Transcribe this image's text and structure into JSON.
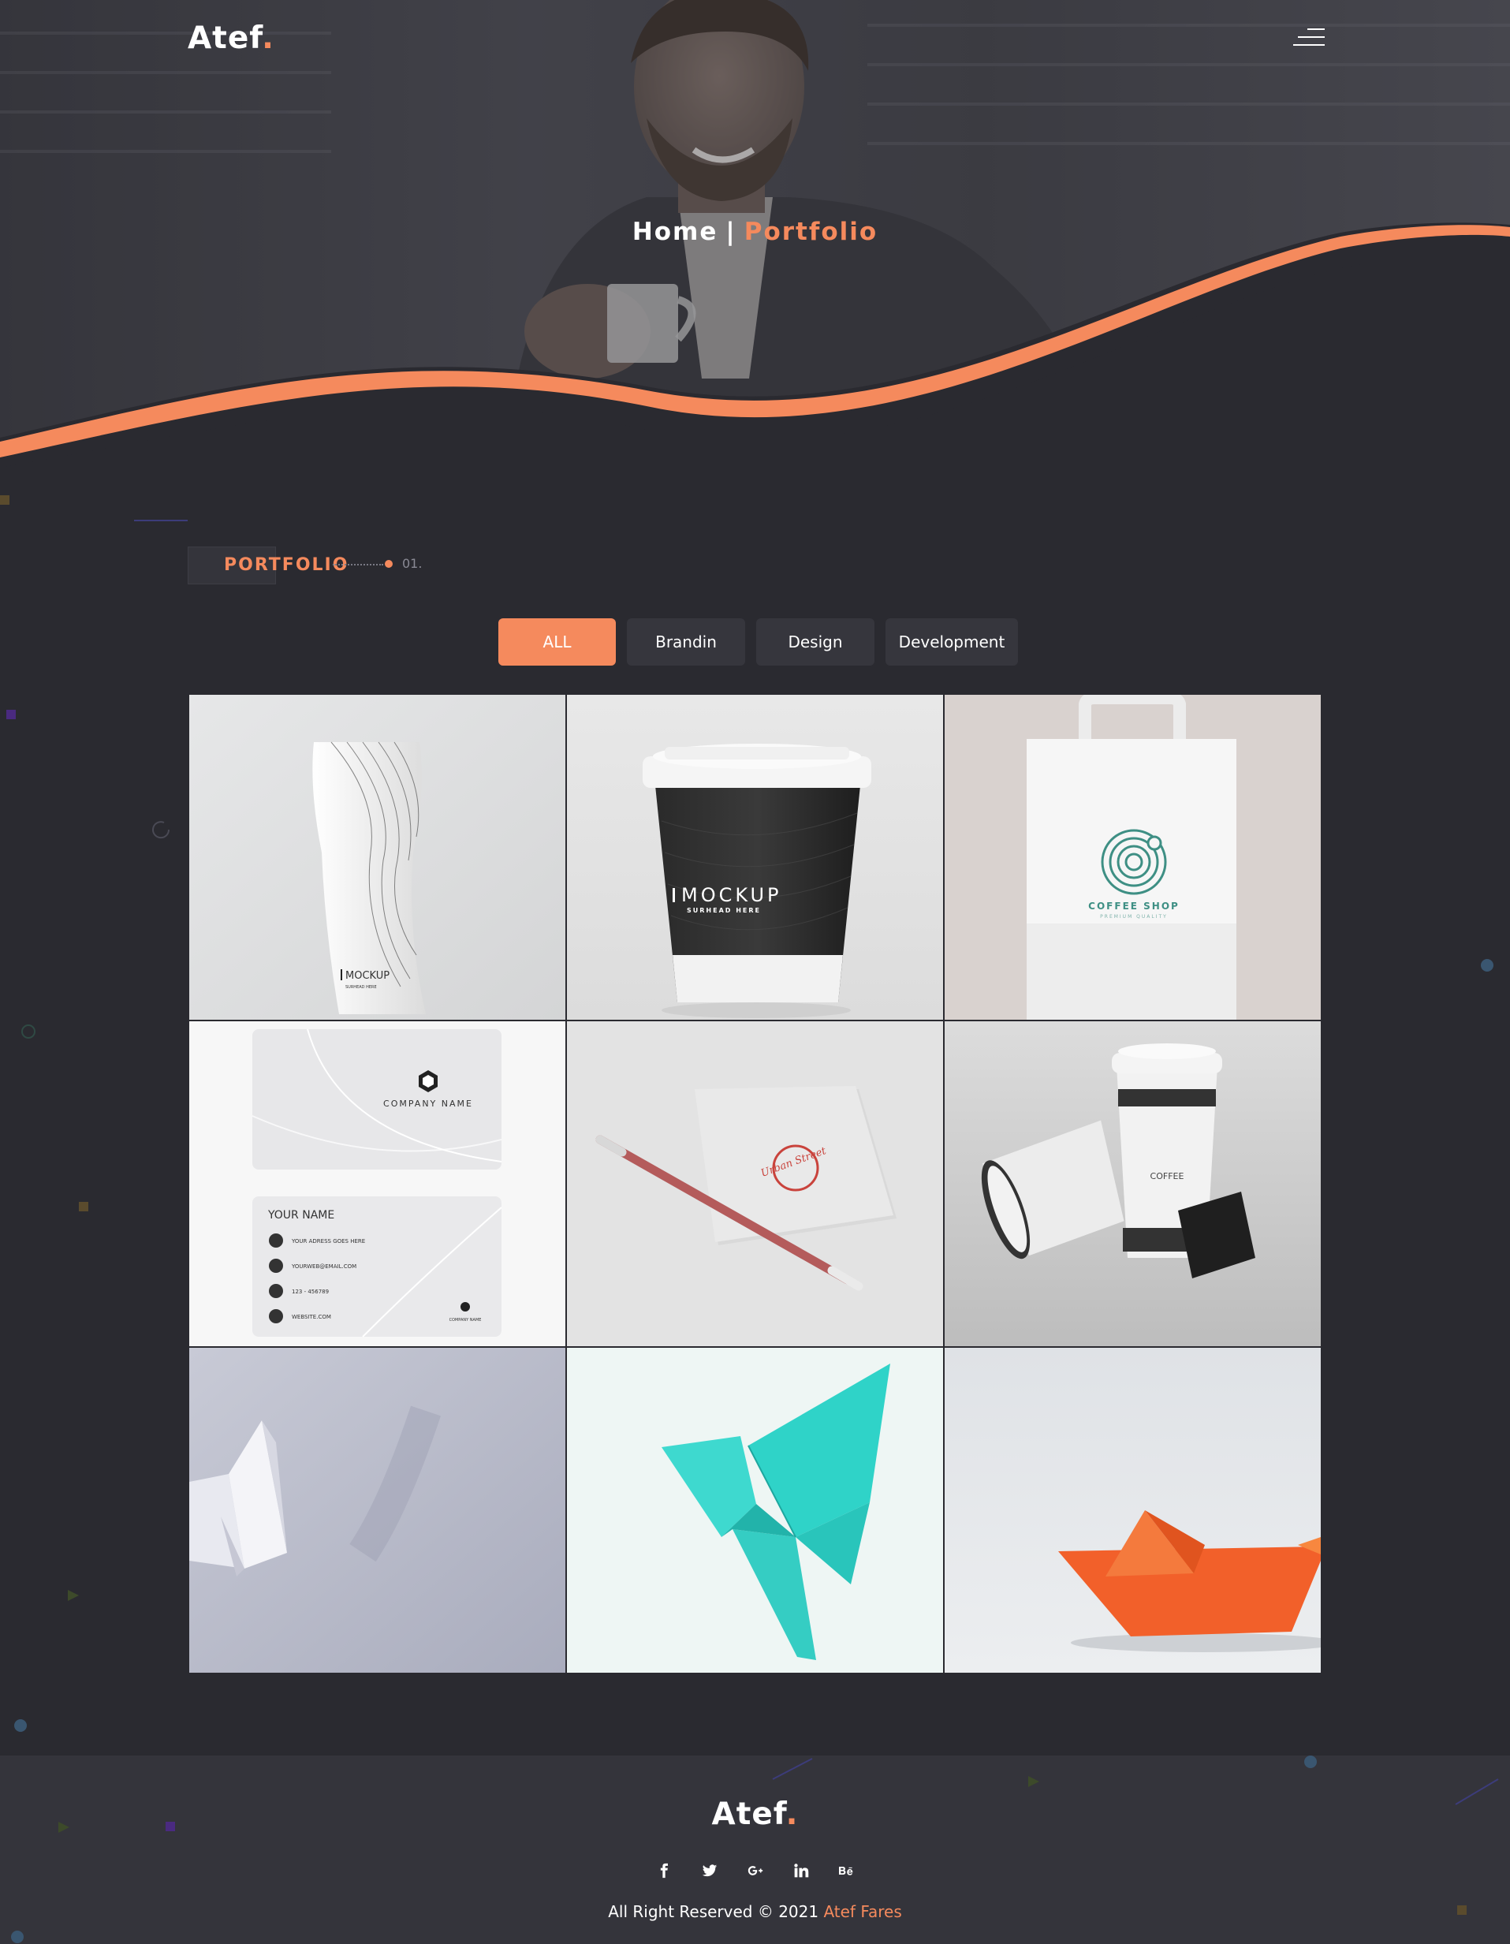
{
  "header": {
    "brand": "Atef",
    "brand_dot": ".",
    "breadcrumb_home": "Home",
    "breadcrumb_sep": "|",
    "breadcrumb_current": "Portfolio"
  },
  "section": {
    "title": "PORTFOLIO",
    "number": "01."
  },
  "filters": [
    {
      "label": "ALL",
      "active": true
    },
    {
      "label": "Brandin",
      "active": false
    },
    {
      "label": "Design",
      "active": false
    },
    {
      "label": "Development",
      "active": false
    }
  ],
  "portfolio": {
    "items": [
      {
        "mockup_text": "MOCKUP",
        "mockup_sub": "SURHEAD HERE"
      },
      {
        "mockup_text": "MOCKUP",
        "mockup_sub": "SURHEAD HERE"
      },
      {
        "mockup_text": "COFFEE SHOP",
        "mockup_sub": "PREMIUM QUALITY"
      },
      {
        "card_company": "COMPANY NAME",
        "card_name": "YOUR NAME",
        "card_address": "YOUR ADRESS GOES HERE",
        "card_email": "YOURWEB@EMAIL.COM",
        "card_phone": "123 - 456789",
        "card_web": "WEBSITE.COM"
      },
      {
        "stamp_text": "Urban Street"
      },
      {
        "cup_text": "COFFEE"
      },
      {},
      {},
      {}
    ]
  },
  "footer": {
    "brand": "Atef",
    "brand_dot": ".",
    "socials": [
      "facebook-icon",
      "twitter-icon",
      "google-plus-icon",
      "linkedin-icon",
      "behance-icon"
    ],
    "copyright_prefix": "All Right Reserved © 2021",
    "copyright_author": "Atef Fares"
  },
  "colors": {
    "accent": "#f58a5d",
    "background": "#2a2a30",
    "footer_bg": "#34343b"
  }
}
